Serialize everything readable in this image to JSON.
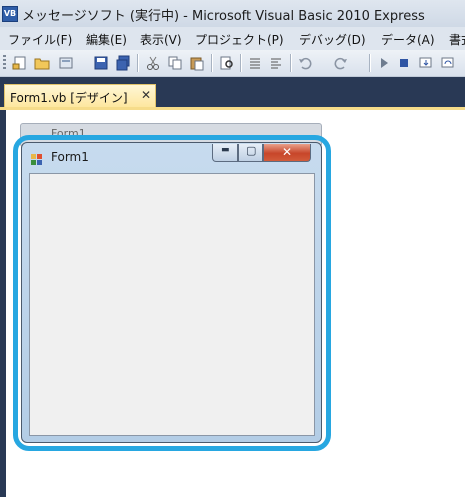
{
  "window": {
    "title": "メッセージソフト (実行中) - Microsoft Visual Basic 2010 Express",
    "icon": "vb-app-icon",
    "icon_text": "VB"
  },
  "menu": {
    "items": [
      {
        "label": "ファイル(F)"
      },
      {
        "label": "編集(E)"
      },
      {
        "label": "表示(V)"
      },
      {
        "label": "プロジェクト(P)"
      },
      {
        "label": "デバッグ(D)"
      },
      {
        "label": "データ(A)"
      },
      {
        "label": "書式"
      }
    ]
  },
  "toolbar": {
    "icons": [
      "new-project-icon",
      "open-file-icon",
      "add-item-icon",
      "save-icon",
      "save-all-icon",
      "cut-icon",
      "copy-icon",
      "paste-icon",
      "find-icon",
      "comment-icon",
      "uncomment-icon",
      "undo-icon",
      "redo-icon",
      "start-debug-icon",
      "stop-debug-icon",
      "step-into-icon",
      "step-over-icon"
    ]
  },
  "tabs": [
    {
      "label": "Form1.vb [デザイン]",
      "close": "✕",
      "active": true
    }
  ],
  "designer": {
    "form_title": "Form1",
    "ghost_title": "Form1",
    "min_glyph": "▬",
    "max_glyph": "▢",
    "close_glyph": "✕"
  },
  "colors": {
    "selection_ring": "#27a7e1",
    "tab_active": "#fde59a",
    "ide_dark": "#293955"
  }
}
